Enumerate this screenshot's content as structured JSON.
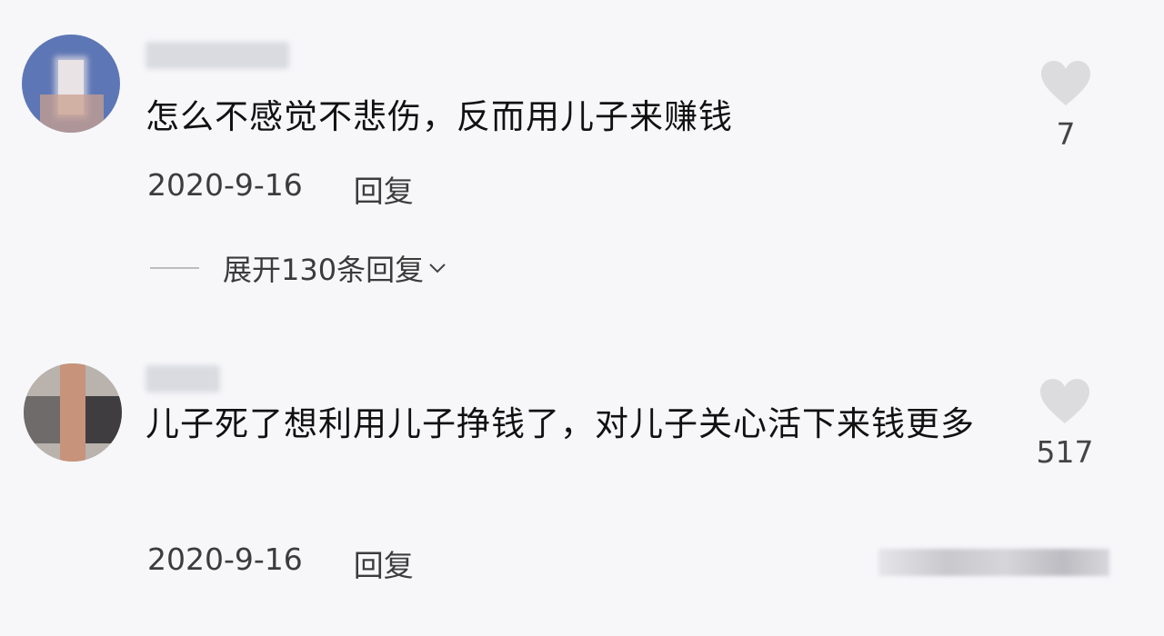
{
  "comments": [
    {
      "text": "怎么不感觉不悲伤，反而用儿子来赚钱",
      "date": "2020-9-16",
      "reply_label": "回复",
      "likes": "7",
      "expand_label": "展开130条回复"
    },
    {
      "text": "儿子死了想利用儿子挣钱了，对儿子关心活下来钱更多",
      "date": "2020-9-16",
      "reply_label": "回复",
      "likes": "517"
    }
  ],
  "icons": {
    "like": "heart-icon",
    "expand": "chevron-down-icon"
  },
  "colors": {
    "background": "#f7f7fa",
    "heart": "#dcdcdf",
    "text": "#111111"
  }
}
